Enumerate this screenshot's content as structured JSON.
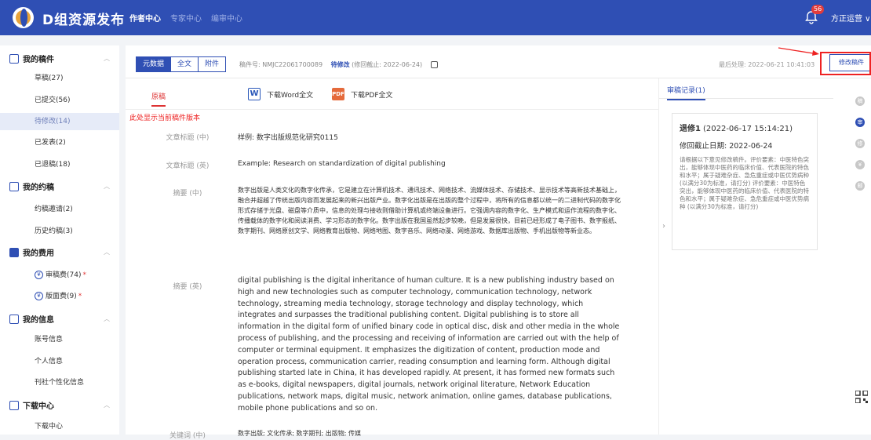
{
  "app": {
    "brand": "D组资源发布",
    "nav": [
      "作者中心",
      "专家中心",
      "编审中心"
    ],
    "bell_count": "56",
    "user": "方正运营 ∨"
  },
  "sidebar": {
    "groups": [
      {
        "label": "我的稿件",
        "items": [
          "草稿(27)",
          "已提交(56)",
          "待修改(14)",
          "已发表(2)",
          "已退稿(18)"
        ]
      },
      {
        "label": "我的约稿",
        "items": [
          "约稿邀请(2)",
          "历史约稿(3)"
        ]
      },
      {
        "label": "我的费用",
        "items": [
          "审稿费(74)",
          "版面费(9)"
        ]
      },
      {
        "label": "我的信息",
        "items": [
          "账号信息",
          "个人信息",
          "刊社个性化信息"
        ]
      },
      {
        "label": "下载中心",
        "items": [
          "下载中心"
        ]
      }
    ],
    "coin_glyph": "¥",
    "star": "*"
  },
  "toolbar": {
    "segments": [
      "元数据",
      "全文",
      "附件"
    ],
    "manuscript_no": "稿件号: NMJC22061700089",
    "status": "待修改",
    "deadline": "(修回截止: 2022-06-24)",
    "last_processed": "最后处理: 2022-06-21 10:41:03",
    "modify_button": "修改稿件"
  },
  "doc": {
    "tab": "原稿",
    "download_word": "下载Word全文",
    "download_pdf": "下载PDF全文",
    "word_glyph": "W",
    "pdf_glyph": "PDF",
    "version_note": "此处显示当前稿件版本",
    "fields": {
      "title_zh_label": "文章标题 (中)",
      "title_zh": "样例: 数字出版规范化研究0115",
      "title_en_label": "文章标题 (英)",
      "title_en": "Example: Research on standardization of digital publishing",
      "abstract_zh_label": "摘要 (中)",
      "abstract_zh": "数字出版是人类文化的数字化传承，它是建立在计算机技术、通讯技术、网络技术、流媒体技术、存储技术、显示技术等高新技术基础上，融合并超越了传统出版内容而发展起来的新兴出版产业。数字化出版是在出版的整个过程中，将所有的信息都以统一的二进制代码的数字化形式存储于光盘、磁盘等介质中，信息的处理与接收则借助计算机或终端设备进行。它强调内容的数字化、生产模式和运作流程的数字化、传播载体的数字化和阅读消费、学习形态的数字化。数字出版在我国虽然起步较晚，但是发展很快，目前已经形成了电子图书、数字报纸、数字期刊、网络原创文学、网络教育出版物、网络地图、数字音乐、网络动漫、网络游戏、数据库出版物、手机出版物等新业态。",
      "abstract_en_label": "摘要 (英)",
      "abstract_en": "digital publishing is the digital inheritance of human culture. It is a new publishing industry based on high and new technologies such as computer technology, communication technology, network technology, streaming media technology, storage technology and display technology, which integrates and surpasses the traditional publishing content. Digital publishing is to store all information in the digital form of unified binary code in optical disc, disk and other media in the whole process of publishing, and the processing and receiving of information are carried out with the help of computer or terminal equipment. It emphasizes the digitization of content, production mode and operation process, communication carrier, reading consumption and learning form. Although digital publishing started late in China, it has developed rapidly. At present, it has formed new formats such as e-books, digital newspapers, digital journals, network original literature, Network Education publications, network maps, digital music, network animation, online games, database publications, mobile phone publications and so on.",
      "keywords_zh_label": "关键词 (中)",
      "keywords_zh": "数字出版; 文化传承; 数字期刊; 出版物; 传媒"
    }
  },
  "review": {
    "tab": "审稿记录(1)",
    "title": "退修1",
    "time": "(2022-06-17 15:14:21)",
    "deadline": "修回截止日期:  2022-06-24",
    "body": "请根据以下意见修改稿件。评价要素：中医特色突出，能够体现中医药的临床价值、代表医院的特色和水平；属于疑难杂症、急危重症或中医优势病种  (以满分30为标准，请打分)  评价要素：中医特色突出，能够体现中医药的临床价值、代表医院的特色和水平；属于疑难杂症、急危重症或中医优势病种  (以满分30为标准，请打分)"
  },
  "side_icons": [
    "稿",
    "审",
    "修",
    "¥",
    "邮"
  ]
}
